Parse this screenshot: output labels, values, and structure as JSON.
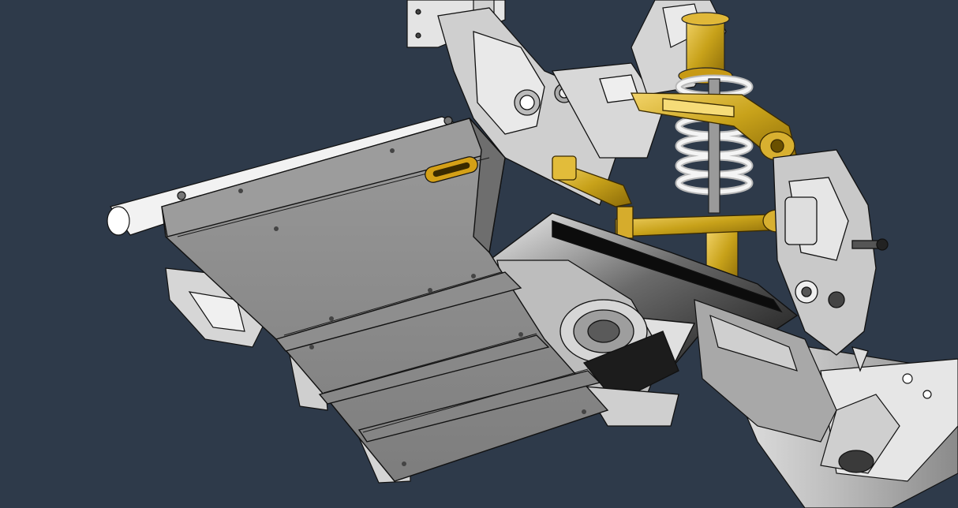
{
  "scene": {
    "background_color": "#2e3a4a",
    "components": [
      {
        "name": "skid-plate",
        "color": "#8f8f8f"
      },
      {
        "name": "frame-rail",
        "color": "#d9d9d9"
      },
      {
        "name": "control-arm",
        "color": "#c8a21a"
      },
      {
        "name": "coilover-spring",
        "color": "#e8e8e8"
      },
      {
        "name": "logo-badge",
        "color": "#d4a017"
      }
    ]
  }
}
